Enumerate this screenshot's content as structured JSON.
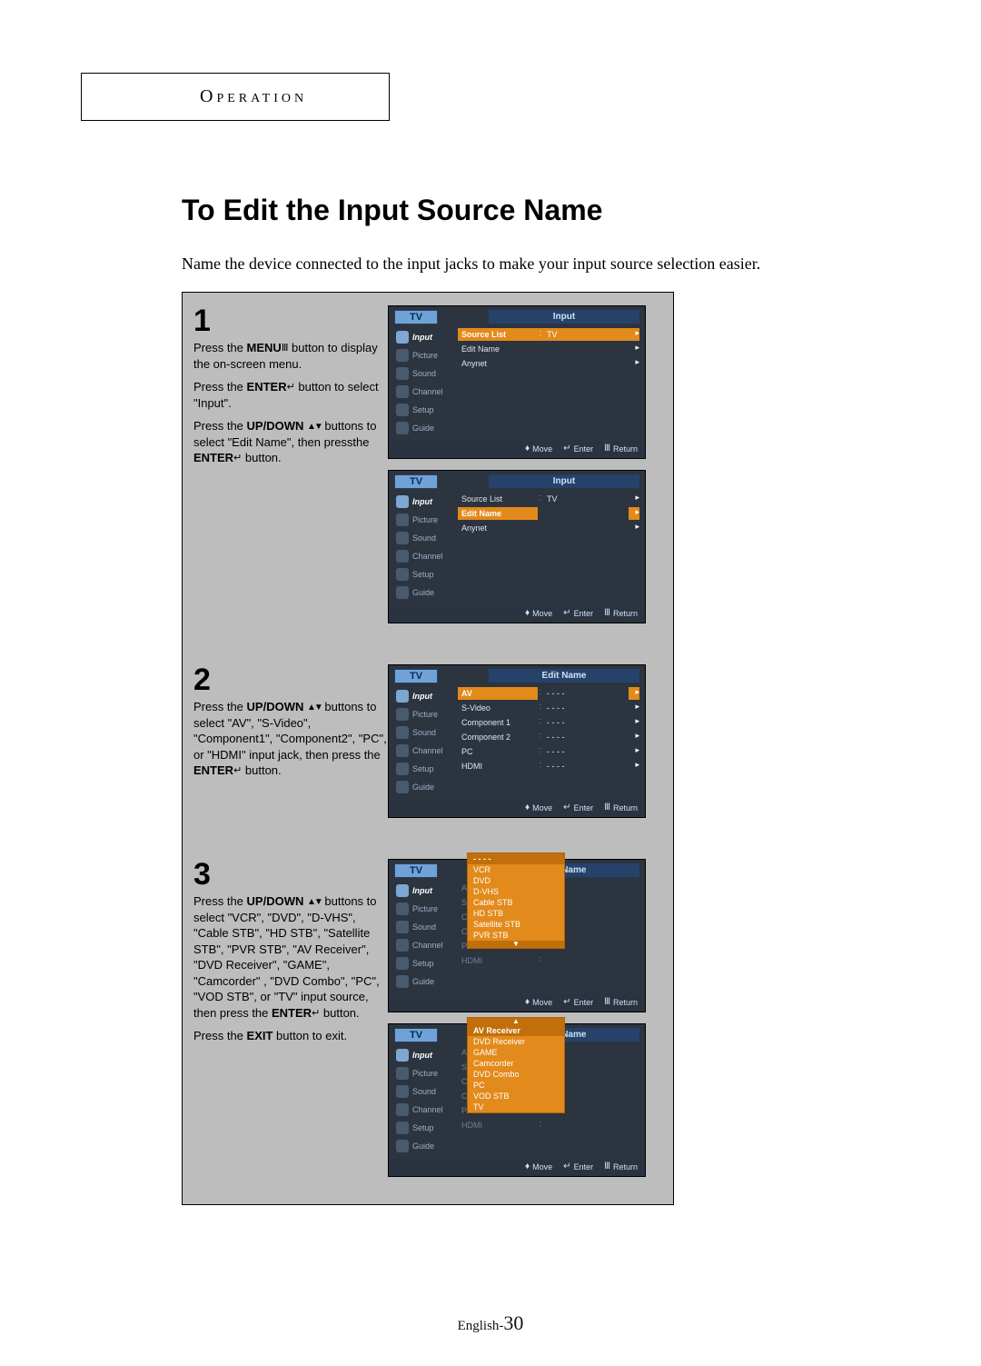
{
  "section_label": "Operation",
  "title": "To Edit the Input Source Name",
  "intro": "Name the device connected to the input jacks to make your input source selection easier.",
  "step1": {
    "num": "1",
    "p1a": "Press the ",
    "p1_menu": "MENU",
    "p1b": " button to display the on-screen menu.",
    "p2a": "Press the ",
    "p2_enter": "ENTER",
    "p2b": " button to select \"Input\".",
    "p3a": "Press the ",
    "p3_updown": "UP/DOWN",
    "p3b": " buttons to select \"Edit Name\", then pressthe ",
    "p3_enter": "ENTER",
    "p3c": " button."
  },
  "step2": {
    "num": "2",
    "p1a": "Press the ",
    "p1_updown": "UP/DOWN",
    "p1b": " buttons to select \"AV\", \"S-Video\", \"Component1\", \"Component2\", \"PC\", or \"HDMI\" input jack, then press the ",
    "p1_enter": "ENTER",
    "p1c": " button."
  },
  "step3": {
    "num": "3",
    "p1a": "Press the ",
    "p1_updown": "UP/DOWN",
    "p1b": " buttons to select \"VCR\", \"DVD\", \"D-VHS\", \"Cable STB\", \"HD STB\", \"Satellite STB\", \"PVR STB\", \"AV Receiver\", \"DVD Receiver\", \"GAME\", \"Camcorder\" , \"DVD Combo\", \"PC\", \"VOD STB\", or \"TV\" input source, then press the ",
    "p1_enter": "ENTER",
    "p1c": " button.",
    "p2a": "Press the ",
    "p2_exit": "EXIT",
    "p2b": " button to exit."
  },
  "osd_nav": {
    "input": "Input",
    "picture": "Picture",
    "sound": "Sound",
    "channel": "Channel",
    "setup": "Setup",
    "guide": "Guide"
  },
  "osd_footer": {
    "move": "Move",
    "enter": "Enter",
    "return": "Return"
  },
  "osd_common": {
    "tv": "TV",
    "input_panel": "Input",
    "edit_name_panel": "Edit Name"
  },
  "osd1a": {
    "row1_lbl": "Source List",
    "row1_val": "TV",
    "row2_lbl": "Edit Name",
    "row3_lbl": "Anynet"
  },
  "osd1b": {
    "row1_lbl": "Source List",
    "row1_val": "TV",
    "row2_lbl": "Edit Name",
    "row3_lbl": "Anynet"
  },
  "osd2": {
    "rows": [
      "AV",
      "S-Video",
      "Component 1",
      "Component 2",
      "PC",
      "HDMI"
    ],
    "val": "- - - -"
  },
  "osd3a": {
    "rows": [
      "AV",
      "S-Video",
      "Component 1",
      "Component 2",
      "PC",
      "HDMI"
    ],
    "drop": [
      "- - - -",
      "VCR",
      "DVD",
      "D-VHS",
      "Cable STB",
      "HD STB",
      "Satellite STB",
      "PVR STB"
    ]
  },
  "osd3b": {
    "rows": [
      "AV",
      "S-Video",
      "Component 1",
      "Component 2",
      "PC",
      "HDMI"
    ],
    "drop": [
      "AV  Receiver",
      "DVD Receiver",
      "GAME",
      "Camcorder",
      "DVD Combo",
      "PC",
      "VOD STB",
      "TV"
    ]
  },
  "page_footer": {
    "prefix": "English-",
    "num": "30"
  }
}
